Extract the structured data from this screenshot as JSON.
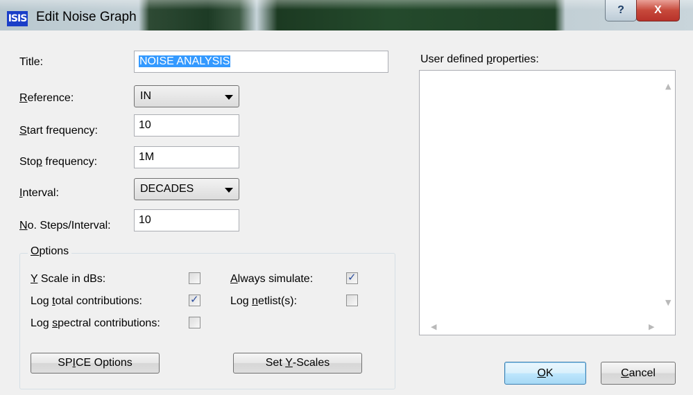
{
  "window": {
    "app_icon_text": "ISIS",
    "title": "Edit Noise Graph",
    "help_label": "?",
    "close_label": "X"
  },
  "form": {
    "title_label": "Title:",
    "title_value": "NOISE ANALYSIS",
    "reference_label": "Reference:",
    "reference_value": "IN",
    "start_label": "Start frequency:",
    "start_value": "10",
    "stop_label": "Stop frequency:",
    "stop_value": "1M",
    "interval_label": "Interval:",
    "interval_value": "DECADES",
    "steps_label": "No. Steps/Interval:",
    "steps_value": "10"
  },
  "options": {
    "legend": "Options",
    "yscale_label": "Y Scale in dBs:",
    "yscale_checked": false,
    "always_label": "Always simulate:",
    "always_checked": true,
    "logtotal_label": "Log total contributions:",
    "logtotal_checked": true,
    "lognetlist_label": "Log netlist(s):",
    "lognetlist_checked": false,
    "logspectral_label": "Log spectral contributions:",
    "logspectral_checked": false,
    "spice_button": "SPICE Options",
    "yscales_button": "Set Y-Scales"
  },
  "properties": {
    "label": "User defined properties:",
    "content": ""
  },
  "footer": {
    "ok_label": "OK",
    "cancel_label": "Cancel"
  }
}
